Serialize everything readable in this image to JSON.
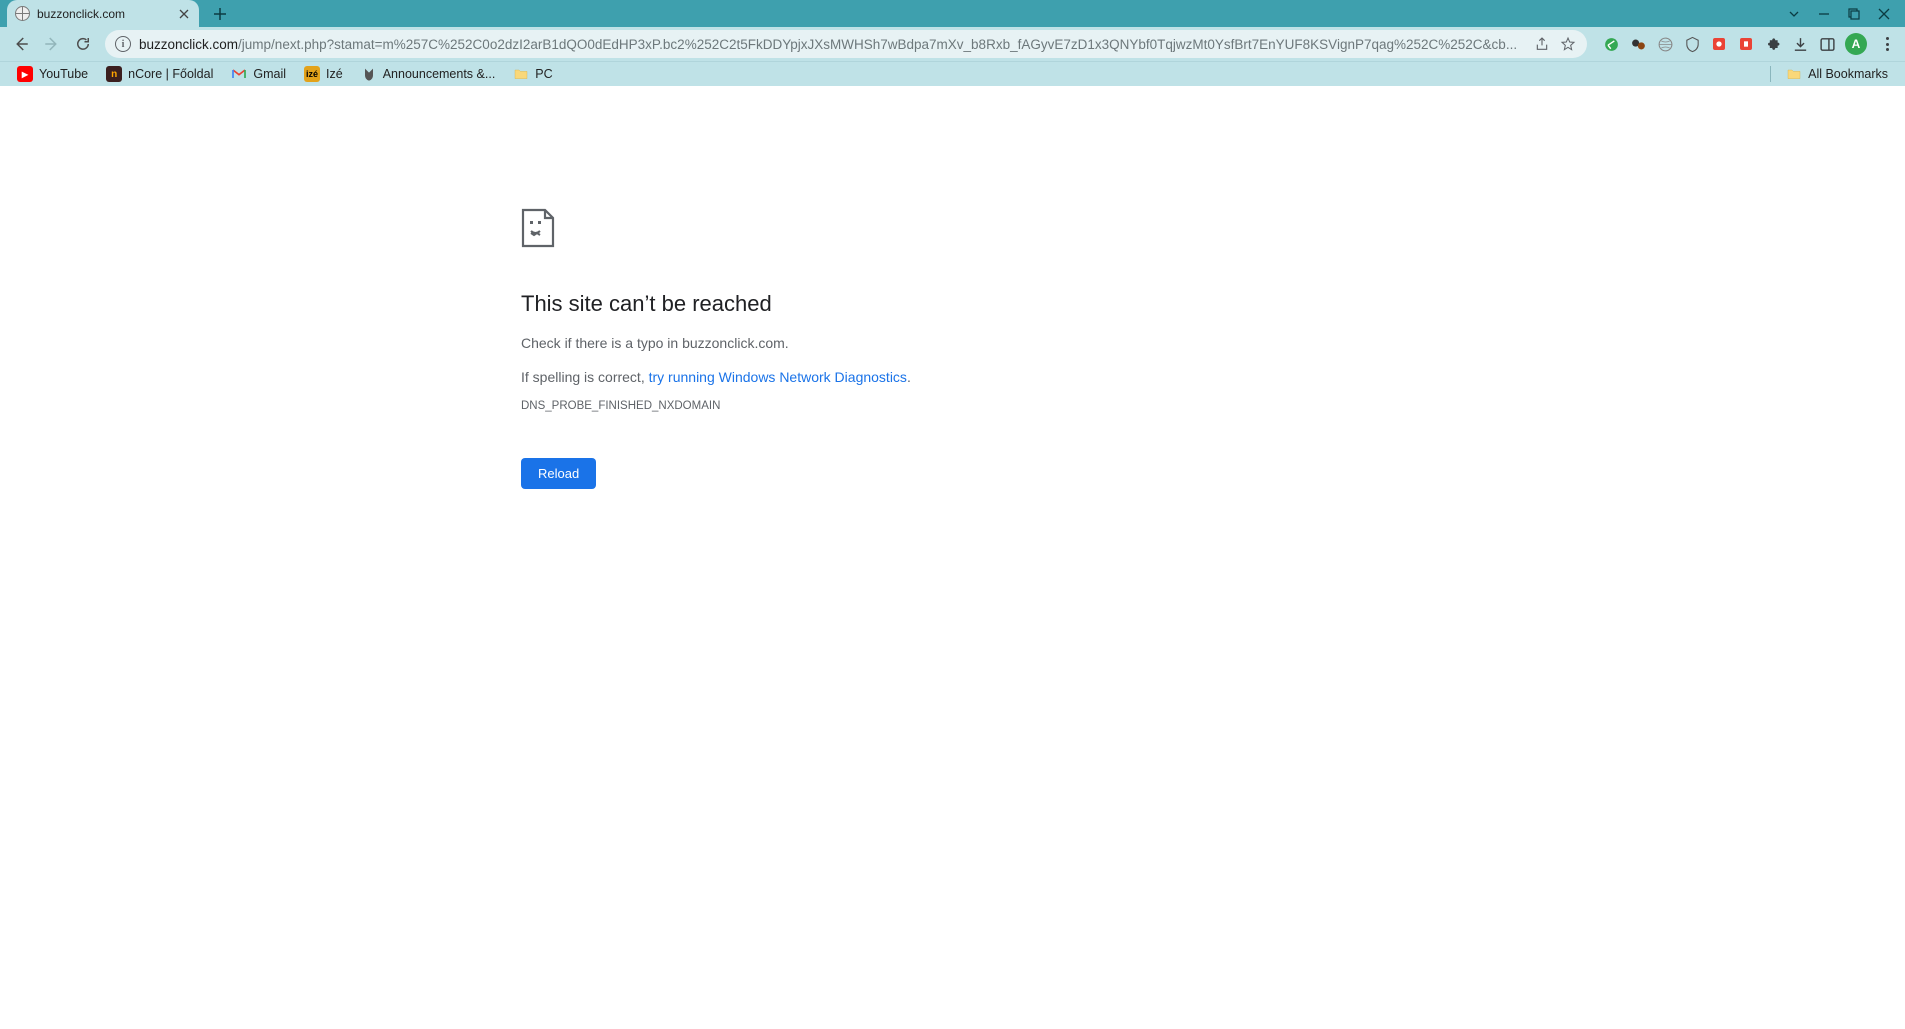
{
  "tab": {
    "title": "buzzonclick.com"
  },
  "url": {
    "domain": "buzzonclick.com",
    "path": "/jump/next.php?stamat=m%257C%252C0o2dzI2arB1dQO0dEdHP3xP.bc2%252C2t5FkDDYpjxJXsMWHSh7wBdpa7mXv_b8Rxb_fAGyvE7zD1x3QNYbf0TqjwzMt0YsfBrt7EnYUF8KSVignP7qag%252C%252C&cb..."
  },
  "bookmarks": {
    "items": [
      {
        "label": "YouTube"
      },
      {
        "label": "nCore | Főoldal"
      },
      {
        "label": "Gmail"
      },
      {
        "label": "Izé"
      },
      {
        "label": "Announcements &..."
      },
      {
        "label": "PC"
      }
    ],
    "all": "All Bookmarks"
  },
  "avatar": {
    "letter": "A"
  },
  "error": {
    "heading": "This site can’t be reached",
    "check_text_pre": "Check if there is a typo in ",
    "check_domain": "buzzonclick.com",
    "spelling_pre": "If spelling is correct, ",
    "diag_link": "try running Windows Network Diagnostics",
    "code": "DNS_PROBE_FINISHED_NXDOMAIN",
    "reload": "Reload"
  }
}
